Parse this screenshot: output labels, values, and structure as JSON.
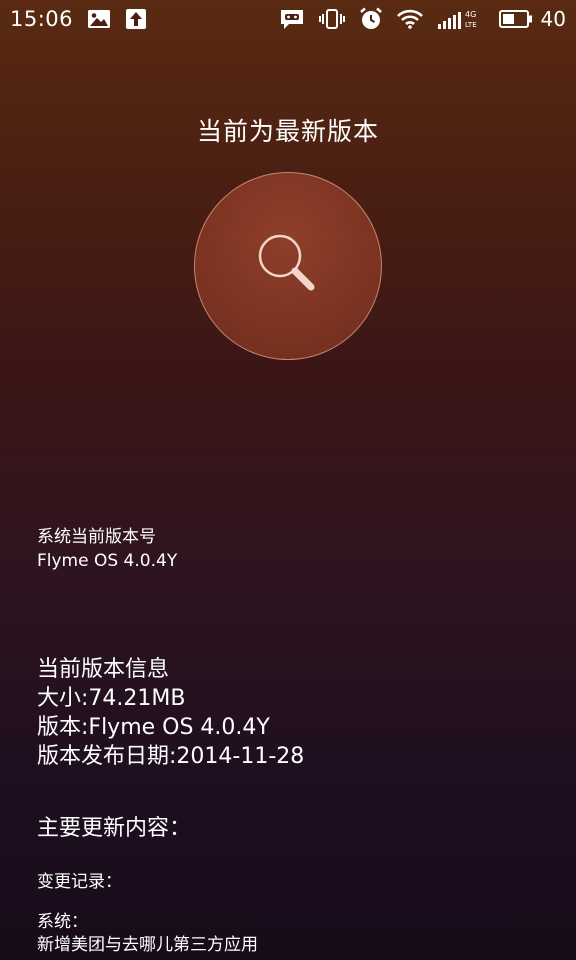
{
  "status_bar": {
    "time": "15:06",
    "battery_level": "40",
    "network_label_top": "4G",
    "network_label_bottom": "LTE",
    "left_icons": [
      "image-icon",
      "upload-icon"
    ],
    "right_icons": [
      "message-icon",
      "vibrate-icon",
      "alarm-icon",
      "wifi-icon",
      "signal-icon",
      "battery-icon"
    ]
  },
  "main": {
    "title": "当前为最新版本",
    "check_button_icon": "search-icon"
  },
  "current_version": {
    "label": "系统当前版本号",
    "value": "Flyme OS 4.0.4Y"
  },
  "version_info": {
    "heading": "当前版本信息",
    "size": "大小:74.21MB",
    "version": "版本:Flyme OS 4.0.4Y",
    "release_date": "版本发布日期:2014-11-28"
  },
  "updates": {
    "heading": "主要更新内容：",
    "changelog_label": "变更记录：",
    "system_label": "系统：",
    "system_item_1": "新增美团与去哪儿第三方应用"
  },
  "colors": {
    "accent_circle": "#7c3322",
    "background_top": "#5a2b12",
    "background_bottom": "#170b1a"
  }
}
